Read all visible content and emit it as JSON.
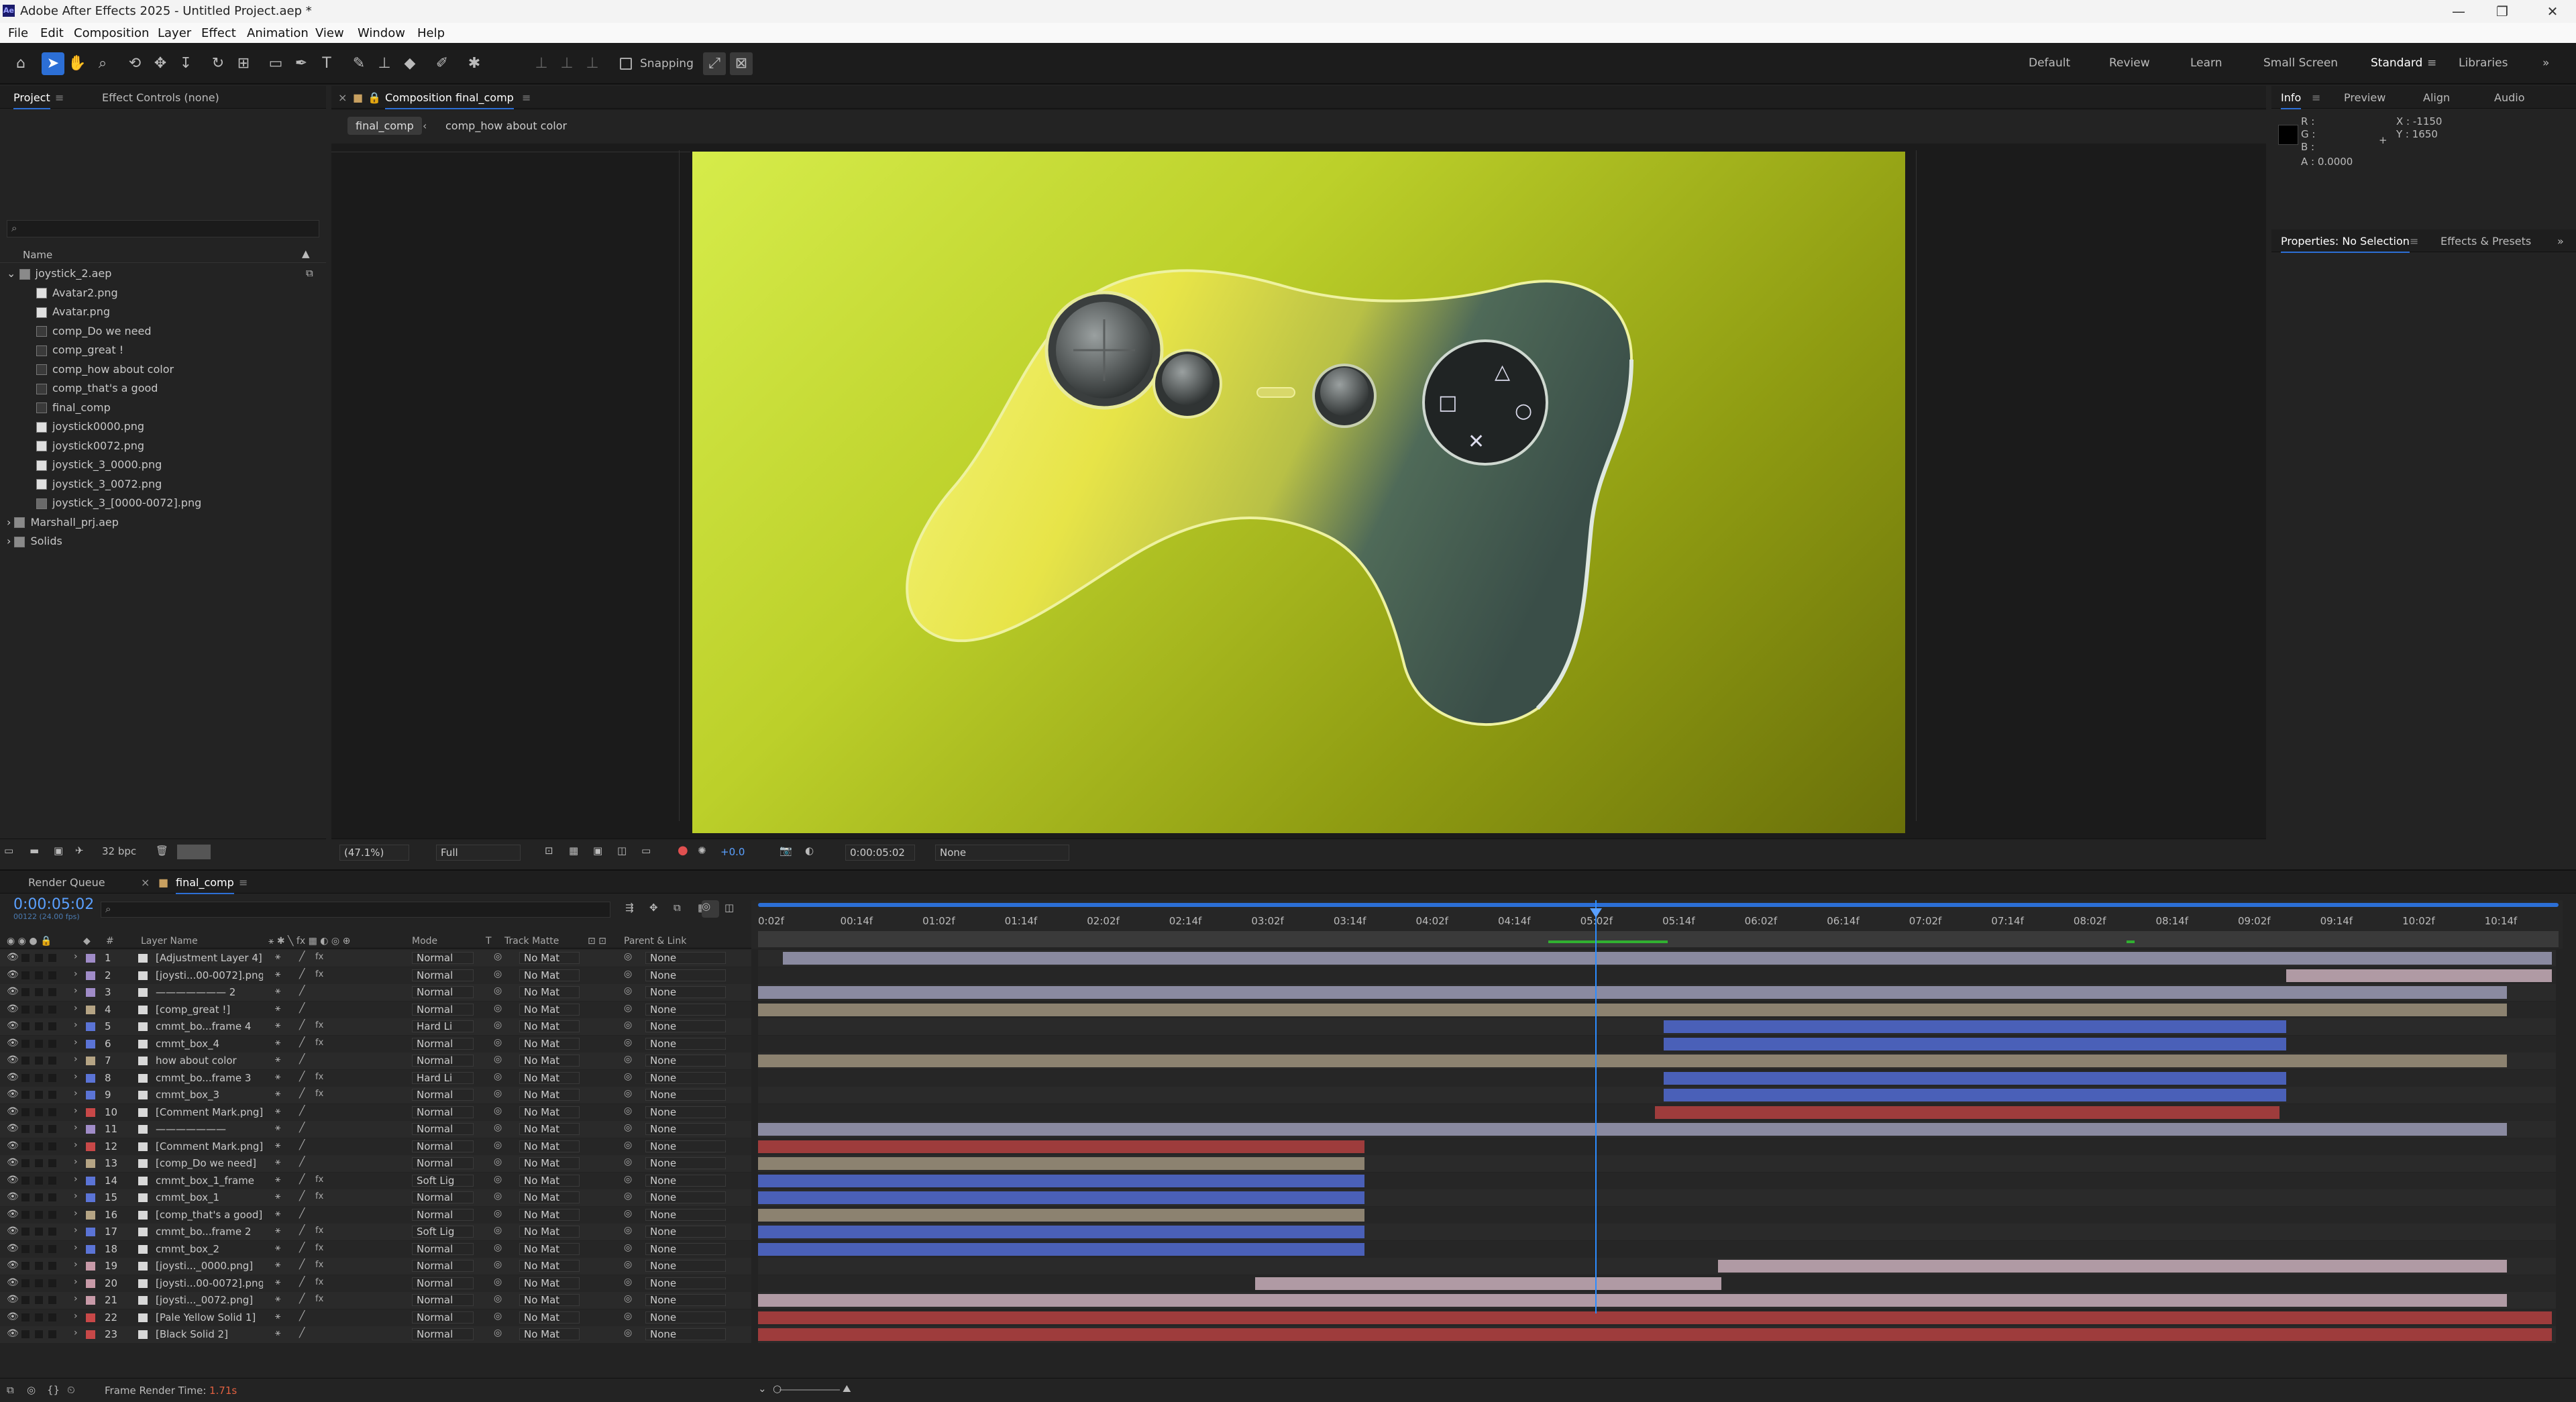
{
  "app": {
    "title": "Adobe After Effects 2025 - Untitled Project.aep *",
    "logo": "Ae"
  },
  "window_controls": {
    "min": "—",
    "max": "❐",
    "close": "✕"
  },
  "menu": [
    "File",
    "Edit",
    "Composition",
    "Layer",
    "Effect",
    "Animation",
    "View",
    "Window",
    "Help"
  ],
  "toolbar": {
    "snapping": "Snapping"
  },
  "workspaces": [
    "Default",
    "Review",
    "Learn",
    "Small Screen",
    "Standard",
    "Libraries"
  ],
  "project_panel": {
    "tabs": [
      "Project",
      "Effect Controls (none)"
    ],
    "column_name": "Name",
    "search_placeholder": "",
    "bpc": "32 bpc",
    "items": [
      {
        "name": "joystick_2.aep",
        "type": "folder",
        "level": 0,
        "open": true
      },
      {
        "name": "Avatar2.png",
        "type": "image",
        "level": 1
      },
      {
        "name": "Avatar.png",
        "type": "image",
        "level": 1
      },
      {
        "name": "comp_Do we need",
        "type": "comp",
        "level": 1
      },
      {
        "name": "comp_great !",
        "type": "comp",
        "level": 1
      },
      {
        "name": "comp_how about color",
        "type": "comp",
        "level": 1
      },
      {
        "name": "comp_that's a good",
        "type": "comp",
        "level": 1
      },
      {
        "name": "final_comp",
        "type": "comp",
        "level": 1
      },
      {
        "name": "joystick0000.png",
        "type": "image",
        "level": 1
      },
      {
        "name": "joystick0072.png",
        "type": "image",
        "level": 1
      },
      {
        "name": "joystick_3_0000.png",
        "type": "image",
        "level": 1
      },
      {
        "name": "joystick_3_0072.png",
        "type": "image",
        "level": 1
      },
      {
        "name": "joystick_3_[0000-0072].png",
        "type": "seq",
        "level": 1
      },
      {
        "name": "Marshall_prj.aep",
        "type": "folder",
        "level": 0,
        "open": false
      },
      {
        "name": "Solids",
        "type": "folder",
        "level": 0,
        "open": false
      }
    ]
  },
  "composition_panel": {
    "tab": "Composition final_comp",
    "breadcrumbs": [
      "final_comp",
      "comp_how about color"
    ],
    "zoom": "(47.1%)",
    "resolution": "Full",
    "exposure": "+0.0",
    "timecode": "0:00:05:02",
    "view": "None"
  },
  "info_panel": {
    "tabs": [
      "Info",
      "Preview",
      "Align",
      "Audio"
    ],
    "r": "R :",
    "g": "G :",
    "b": "B :",
    "a": "A : 0.0000",
    "x": "X : -1150",
    "y": "Y : 1650"
  },
  "properties_panel": {
    "tabs": [
      "Properties: No Selection",
      "Effects & Presets"
    ]
  },
  "timeline": {
    "tabs": [
      "Render Queue",
      "final_comp"
    ],
    "timecode": "0:00:05:02",
    "frame_info": "00122 (24.00 fps)",
    "columns": {
      "num": "#",
      "name": "Layer Name",
      "mode": "Mode",
      "t": "T",
      "matte": "Track Matte",
      "parent": "Parent & Link"
    },
    "ruler": [
      "0:02f",
      "00:14f",
      "01:02f",
      "01:14f",
      "02:02f",
      "02:14f",
      "03:02f",
      "03:14f",
      "04:02f",
      "04:14f",
      "05:02f",
      "05:14f",
      "06:02f",
      "06:14f",
      "07:02f",
      "07:14f",
      "08:02f",
      "08:14f",
      "09:02f",
      "09:14f",
      "10:02f",
      "10:14f"
    ],
    "playhead_frac": 0.4667,
    "footer": {
      "label": "Frame Render Time:",
      "value": "1.71s"
    },
    "layers": [
      {
        "n": "1",
        "name": "[Adjustment Layer 4]",
        "mode": "Normal",
        "matte": "No Mat",
        "parent": "None",
        "label": "#a08cc8",
        "bar": [
          0.014,
          1.0
        ],
        "barcolor": "#8a8aa0",
        "fx": true
      },
      {
        "n": "2",
        "name": "[joysti...00-0072].png]",
        "mode": "Normal",
        "matte": "No Mat",
        "parent": "None",
        "label": "#a08cc8",
        "bar": [
          0.852,
          1.0
        ],
        "barcolor": "#b09aa4",
        "fx": true
      },
      {
        "n": "3",
        "name": "——————— 2",
        "mode": "Normal",
        "matte": "No Mat",
        "parent": "None",
        "label": "#a08cc8",
        "bar": [
          0.0,
          0.975
        ],
        "barcolor": "#8a8aa0",
        "fx": false
      },
      {
        "n": "4",
        "name": "[comp_great !]",
        "mode": "Normal",
        "matte": "No Mat",
        "parent": "None",
        "label": "#b5a484",
        "bar": [
          0.0,
          0.975
        ],
        "barcolor": "#8c8270",
        "fx": false
      },
      {
        "n": "5",
        "name": "cmmt_bo...frame 4",
        "mode": "Hard Li",
        "matte": "No Mat",
        "parent": "None",
        "label": "#5b74d6",
        "bar": [
          0.505,
          0.852
        ],
        "barcolor": "#4a60b8",
        "fx": true
      },
      {
        "n": "6",
        "name": "cmmt_box_4",
        "mode": "Normal",
        "matte": "No Mat",
        "parent": "None",
        "label": "#5b74d6",
        "bar": [
          0.505,
          0.852
        ],
        "barcolor": "#4a60b8",
        "fx": true
      },
      {
        "n": "7",
        "name": "how about color",
        "mode": "Normal",
        "matte": "No Mat",
        "parent": "None",
        "label": "#b5a484",
        "bar": [
          0.0,
          0.975
        ],
        "barcolor": "#8c8270",
        "fx": false
      },
      {
        "n": "8",
        "name": "cmmt_bo...frame 3",
        "mode": "Hard Li",
        "matte": "No Mat",
        "parent": "None",
        "label": "#5b74d6",
        "bar": [
          0.505,
          0.852
        ],
        "barcolor": "#4a60b8",
        "fx": true
      },
      {
        "n": "9",
        "name": "cmmt_box_3",
        "mode": "Normal",
        "matte": "No Mat",
        "parent": "None",
        "label": "#5b74d6",
        "bar": [
          0.505,
          0.852
        ],
        "barcolor": "#4a60b8",
        "fx": true
      },
      {
        "n": "10",
        "name": "[Comment Mark.png]",
        "mode": "Normal",
        "matte": "No Mat",
        "parent": "None",
        "label": "#c84848",
        "bar": [
          0.5,
          0.848
        ],
        "barcolor": "#9e3c3c",
        "fx": false
      },
      {
        "n": "11",
        "name": "———————",
        "mode": "Normal",
        "matte": "No Mat",
        "parent": "None",
        "label": "#a08cc8",
        "bar": [
          0.0,
          0.975
        ],
        "barcolor": "#8a8aa0",
        "fx": false
      },
      {
        "n": "12",
        "name": "[Comment Mark.png]",
        "mode": "Normal",
        "matte": "No Mat",
        "parent": "None",
        "label": "#c84848",
        "bar": [
          0.0,
          0.338
        ],
        "barcolor": "#9e3c3c",
        "fx": false
      },
      {
        "n": "13",
        "name": "[comp_Do we need]",
        "mode": "Normal",
        "matte": "No Mat",
        "parent": "None",
        "label": "#b5a484",
        "bar": [
          0.0,
          0.338
        ],
        "barcolor": "#8c8270",
        "fx": false
      },
      {
        "n": "14",
        "name": "cmmt_box_1_frame",
        "mode": "Soft Lig",
        "matte": "No Mat",
        "parent": "None",
        "label": "#5b74d6",
        "bar": [
          0.0,
          0.338
        ],
        "barcolor": "#4a60b8",
        "fx": true
      },
      {
        "n": "15",
        "name": "cmmt_box_1",
        "mode": "Normal",
        "matte": "No Mat",
        "parent": "None",
        "label": "#5b74d6",
        "bar": [
          0.0,
          0.338
        ],
        "barcolor": "#4a60b8",
        "fx": true
      },
      {
        "n": "16",
        "name": "[comp_that's a good]",
        "mode": "Normal",
        "matte": "No Mat",
        "parent": "None",
        "label": "#b5a484",
        "bar": [
          0.0,
          0.338
        ],
        "barcolor": "#8c8270",
        "fx": false
      },
      {
        "n": "17",
        "name": "cmmt_bo...frame 2",
        "mode": "Soft Lig",
        "matte": "No Mat",
        "parent": "None",
        "label": "#5b74d6",
        "bar": [
          0.0,
          0.338
        ],
        "barcolor": "#4a60b8",
        "fx": true
      },
      {
        "n": "18",
        "name": "cmmt_box_2",
        "mode": "Normal",
        "matte": "No Mat",
        "parent": "None",
        "label": "#5b74d6",
        "bar": [
          0.0,
          0.338
        ],
        "barcolor": "#4a60b8",
        "fx": true
      },
      {
        "n": "19",
        "name": "[joysti..._0000.png]",
        "mode": "Normal",
        "matte": "No Mat",
        "parent": "None",
        "label": "#c89aa8",
        "bar": [
          0.535,
          0.975
        ],
        "barcolor": "#b09aa4",
        "fx": true
      },
      {
        "n": "20",
        "name": "[joysti...00-0072].png]",
        "mode": "Normal",
        "matte": "No Mat",
        "parent": "None",
        "label": "#c89aa8",
        "bar": [
          0.277,
          0.537
        ],
        "barcolor": "#b09aa4",
        "fx": true
      },
      {
        "n": "21",
        "name": "[joysti..._0072.png]",
        "mode": "Normal",
        "matte": "No Mat",
        "parent": "None",
        "label": "#c89aa8",
        "bar": [
          0.0,
          0.975
        ],
        "barcolor": "#b09aa4",
        "fx": true
      },
      {
        "n": "22",
        "name": "[Pale Yellow Solid 1]",
        "mode": "Normal",
        "matte": "No Mat",
        "parent": "None",
        "label": "#c84848",
        "bar": [
          0.0,
          1.0
        ],
        "barcolor": "#9e3c3c",
        "fx": false
      },
      {
        "n": "23",
        "name": "[Black Solid 2]",
        "mode": "Normal",
        "matte": "No Mat",
        "parent": "None",
        "label": "#c84848",
        "bar": [
          0.0,
          1.0
        ],
        "barcolor": "#9e3c3c",
        "fx": false
      }
    ]
  }
}
